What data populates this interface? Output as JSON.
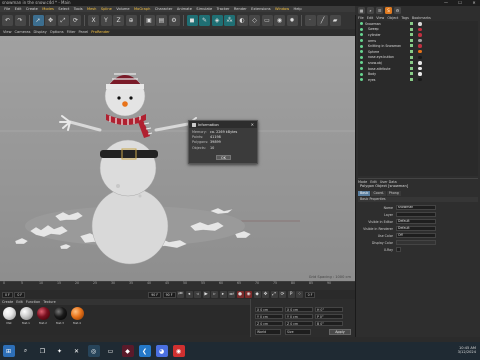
{
  "window": {
    "title": "snowman in the snow.c4d * - Main",
    "controls": [
      "—",
      "☐",
      "✕"
    ]
  },
  "menu": {
    "items": [
      "File",
      "Edit",
      "Create",
      "Modes",
      "Select",
      "Tools",
      "Mesh",
      "Spline",
      "Volume",
      "MoGraph",
      "Character",
      "Animate",
      "Simulate",
      "Tracker",
      "Render",
      "Extensions",
      "Window",
      "Help"
    ]
  },
  "viewport_menu": {
    "items": [
      "View",
      "Cameras",
      "Display",
      "Options",
      "Filter",
      "Panel",
      "ProRender"
    ]
  },
  "viewport": {
    "label": "Perspective",
    "grid_spacing": "Grid Spacing : 1000 cm"
  },
  "info_dialog": {
    "title": "Information",
    "close": "✕",
    "rows": [
      {
        "key": "Memory:",
        "value": "ca. 2269 kBytes"
      },
      {
        "key": "Points:",
        "value": "41198"
      },
      {
        "key": "Polygons:",
        "value": "39899"
      },
      {
        "key": "Objects:",
        "value": "10"
      }
    ],
    "ok_label": "OK"
  },
  "timeline": {
    "ticks": [
      "0",
      "5",
      "10",
      "15",
      "20",
      "25",
      "30",
      "35",
      "40",
      "45",
      "50",
      "55",
      "60",
      "65",
      "70",
      "75",
      "80",
      "85",
      "90"
    ]
  },
  "playback": {
    "start": "0 F",
    "current": "0 F",
    "end": "90 F",
    "end2": "90 F",
    "current_frame": "0 F"
  },
  "materials_menu": {
    "items": [
      "Create",
      "Edit",
      "Function",
      "Texture"
    ]
  },
  "materials": [
    {
      "name": "Mat",
      "color": "#e8e8e8"
    },
    {
      "name": "Mat.1",
      "color": "#cfcfcf"
    },
    {
      "name": "Mat.2",
      "color": "#7a1020"
    },
    {
      "name": "Mat.3",
      "color": "#1a1a1a"
    },
    {
      "name": "Mat.4",
      "color": "#e8731a"
    }
  ],
  "coordinates": {
    "rows": [
      {
        "a": "X 0 cm",
        "b": "X 0 cm",
        "c": "H 0°"
      },
      {
        "a": "Y 0 cm",
        "b": "Y 0 cm",
        "c": "P 0°"
      },
      {
        "a": "Z 0 cm",
        "b": "Z 0 cm",
        "c": "B 0°"
      }
    ],
    "world": "World",
    "size": "Size",
    "apply": "Apply"
  },
  "object_manager": {
    "menu": [
      "File",
      "Edit",
      "View",
      "Object",
      "Tags",
      "Bookmarks"
    ],
    "objects": [
      {
        "name": "Snowman",
        "tag": "#d8d8d8"
      },
      {
        "name": "Sweep",
        "tag": "#c03040"
      },
      {
        "name": "cylinder",
        "tag": "#c03040"
      },
      {
        "name": "arms",
        "tag": "#a0a0a0"
      },
      {
        "name": "Knitting in Snowman",
        "tag": "#c03040"
      },
      {
        "name": "Sphere",
        "tag": "#e8731a"
      },
      {
        "name": "nose.eye.button",
        "tag": "#1a1a1a"
      },
      {
        "name": "snow.obj",
        "tag": "#e8e8e8"
      },
      {
        "name": "base.attribute",
        "tag": "#e8e8e8"
      },
      {
        "name": "Body",
        "tag": "#e8e8e8"
      },
      {
        "name": "eyes",
        "tag": "#1a1a1a"
      }
    ]
  },
  "attributes": {
    "menu": [
      "Mode",
      "Edit",
      "User Data"
    ],
    "title": "Polygon Object [snowman]",
    "tabs": [
      "Basic",
      "Coord.",
      "Phong"
    ],
    "section": "Basic Properties",
    "rows": [
      {
        "key": "Name",
        "value": "snowman"
      },
      {
        "key": "Layer",
        "value": ""
      },
      {
        "key": "Visible in Editor",
        "value": "Default"
      },
      {
        "key": "Visible in Renderer",
        "value": "Default"
      },
      {
        "key": "Use Color",
        "value": "Off"
      },
      {
        "key": "Display Color",
        "value": ""
      },
      {
        "key": "X-Ray",
        "value": ""
      }
    ]
  },
  "taskbar": {
    "time": "10:45 AM",
    "date": "3/12/2024"
  },
  "colors": {
    "accent": "#e07a1f",
    "selection": "#5a7fa0"
  }
}
